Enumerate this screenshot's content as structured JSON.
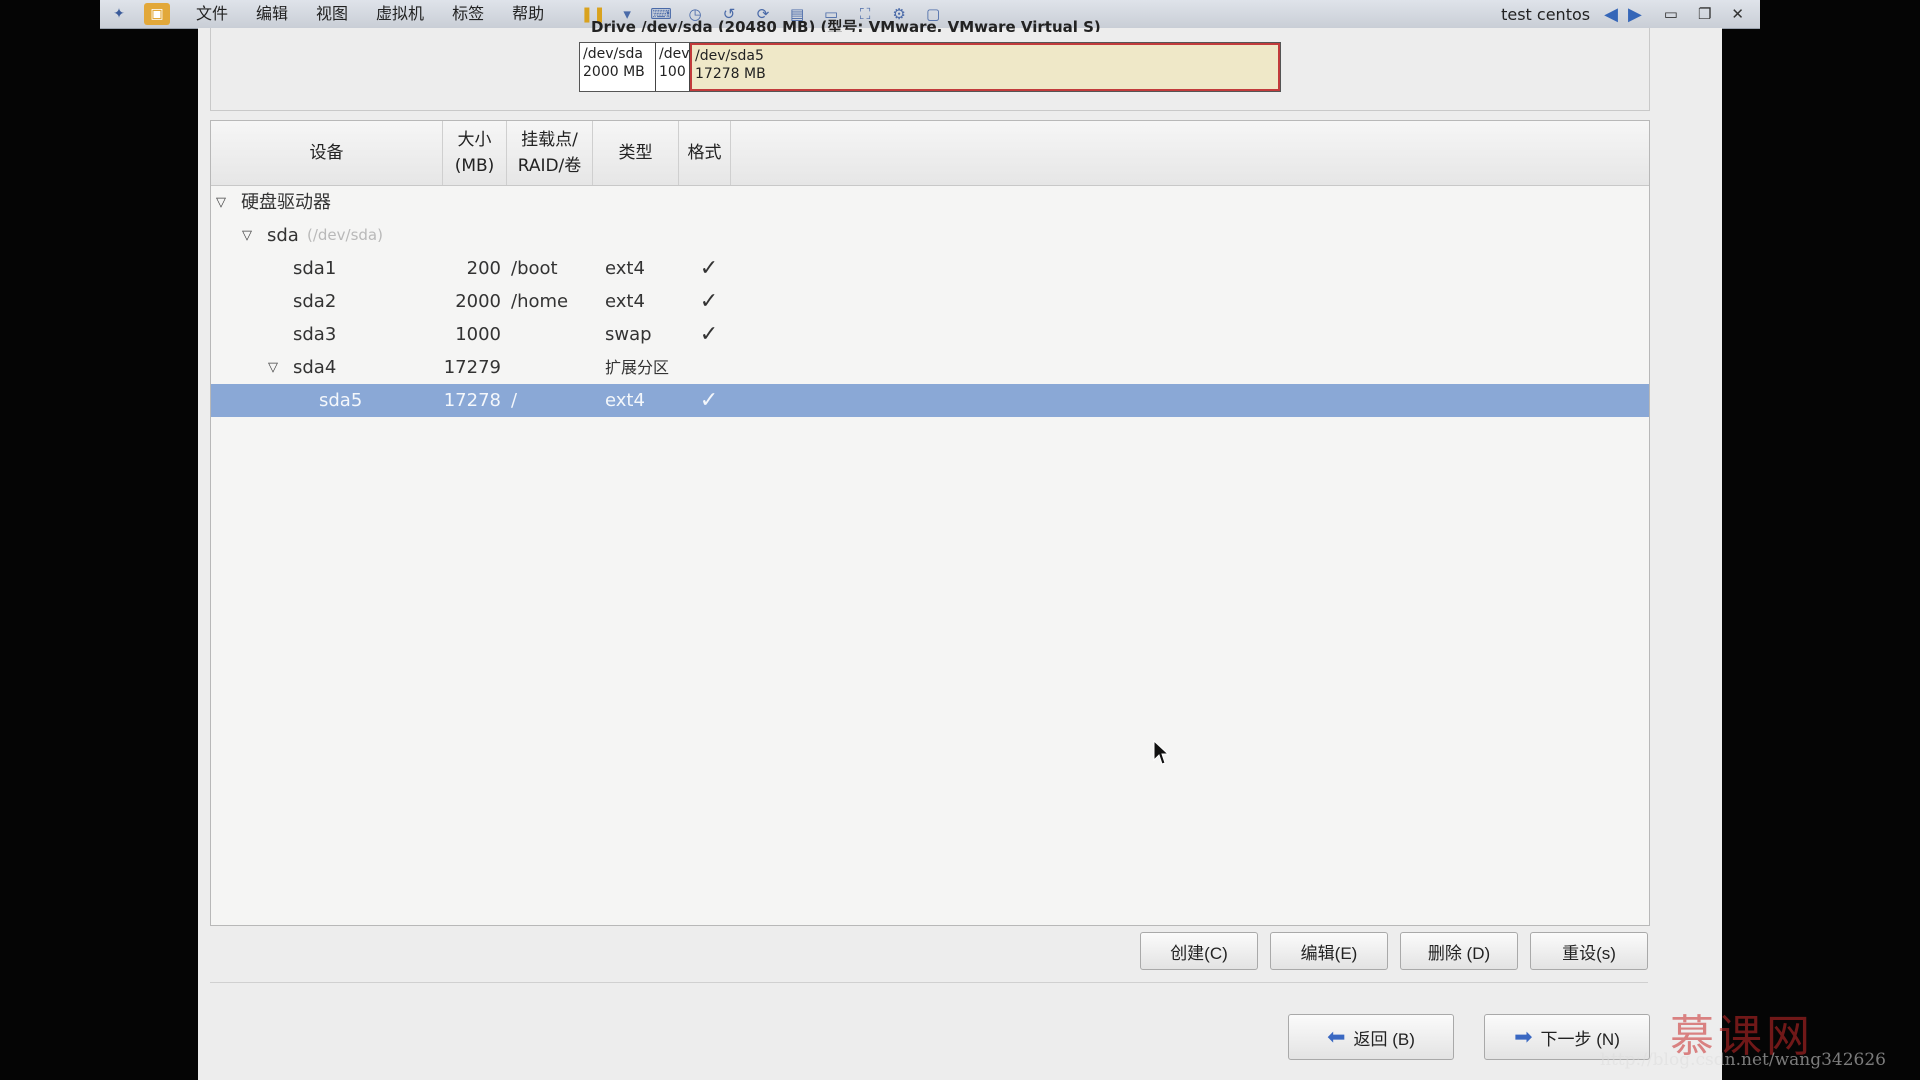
{
  "vm_toolbar": {
    "menu": [
      "文件",
      "编辑",
      "视图",
      "虚拟机",
      "标签",
      "帮助"
    ],
    "title": "test centos"
  },
  "drive": {
    "label": "Drive /dev/sda (20480 MB) (型号: VMware, VMware Virtual S)",
    "segments": [
      {
        "name": "/dev/sda",
        "size": "2000 MB"
      },
      {
        "name": "/dev",
        "size": "100"
      },
      {
        "name": "/dev/sda5",
        "size": "17278 MB"
      }
    ]
  },
  "table": {
    "headers": {
      "device": "设备",
      "size": "大小\n(MB)",
      "mount": "挂载点/\nRAID/卷",
      "type": "类型",
      "format": "格式"
    },
    "group": "硬盘驱动器",
    "disk": {
      "name": "sda",
      "path": "(/dev/sda)"
    },
    "rows": [
      {
        "device": "sda1",
        "size": "200",
        "mount": "/boot",
        "type": "ext4",
        "format": "✓"
      },
      {
        "device": "sda2",
        "size": "2000",
        "mount": "/home",
        "type": "ext4",
        "format": "✓"
      },
      {
        "device": "sda3",
        "size": "1000",
        "mount": "",
        "type": "swap",
        "format": "✓"
      },
      {
        "device": "sda4",
        "size": "17279",
        "mount": "",
        "type": "扩展分区",
        "format": ""
      },
      {
        "device": "sda5",
        "size": "17278",
        "mount": "/",
        "type": "ext4",
        "format": "✓"
      }
    ]
  },
  "buttons": {
    "create": "创建(C)",
    "edit": "编辑(E)",
    "delete": "删除 (D)",
    "reset": "重设(s)",
    "back": "返回 (B)",
    "next": "下一步 (N)"
  },
  "watermark": {
    "logo": "慕课网",
    "url": "http://blog.csdn.net/wang342626"
  }
}
